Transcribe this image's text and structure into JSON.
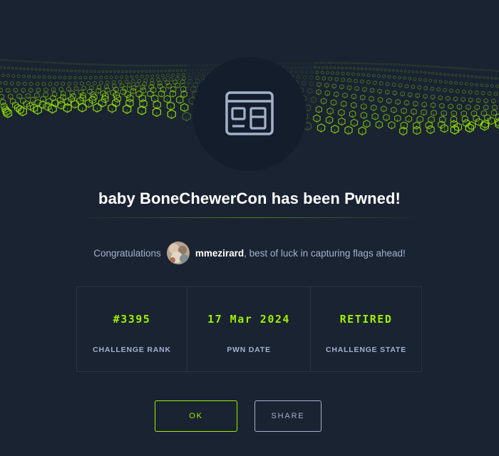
{
  "dialog": {
    "title": "baby BoneChewerCon has been Pwned!",
    "congrats_lead": "Congratulations",
    "username": "mmezirard",
    "congrats_tail": ", best of luck in capturing flags ahead!"
  },
  "challenge_icon": "web-window-icon",
  "stats": [
    {
      "value": "#3395",
      "label": "CHALLENGE RANK"
    },
    {
      "value": "17 Mar 2024",
      "label": "PWN DATE"
    },
    {
      "value": "RETIRED",
      "label": "CHALLENGE STATE"
    }
  ],
  "buttons": {
    "ok": "OK",
    "share": "SHARE"
  },
  "colors": {
    "background": "#1a2332",
    "accent": "#9fef00",
    "muted": "#a4b1cd",
    "panel": "#141d2b"
  }
}
